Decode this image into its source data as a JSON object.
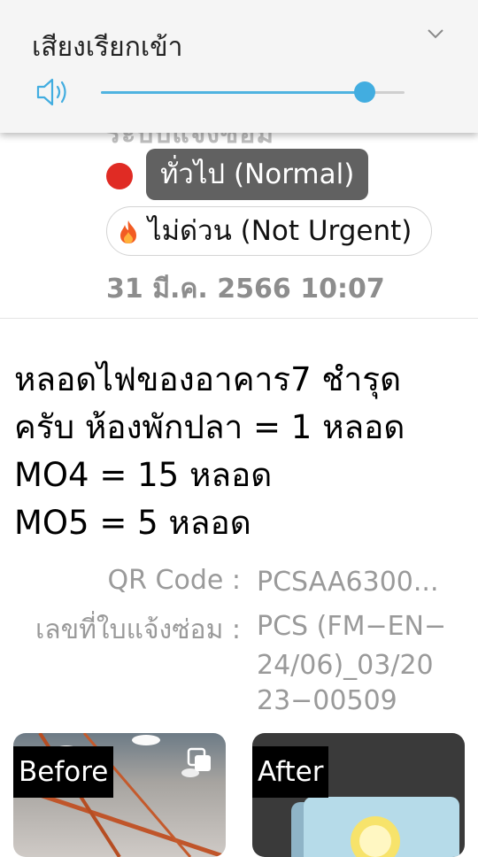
{
  "volume_panel": {
    "title": "เสียงเรียกเข้า",
    "level": 0.87,
    "icons": {
      "speaker": "speaker-icon",
      "collapse": "chevron-down-icon"
    },
    "accent_color": "#42ade0"
  },
  "ticket": {
    "obscured_text": "ระบบแจ้งซ่อม",
    "status_color": "#e02b24",
    "type_label": "ทั่วไป (Normal)",
    "urgency_label": "ไม่ด่วน (Not Urgent)",
    "urgency_icon": "fire-icon",
    "date": "31 มี.ค. 2566 10:07",
    "description_lines": [
      "หลอดไฟของอาคาร7 ชำรุด",
      "ครับ ห้องพักปลา = 1 หลอด",
      "MO4 = 15 หลอด",
      "MO5 = 5 หลอด"
    ],
    "info": {
      "qr_label": "QR Code :",
      "qr_value": "PCSAA6300...",
      "repair_label": "เลขที่ใบแจ้งซ่อม :",
      "repair_value_lines": [
        "PCS (FM−EN−",
        "24/06)_03/20",
        "23−00509"
      ]
    },
    "photos": {
      "before_label": "Before",
      "after_label": "After"
    }
  }
}
